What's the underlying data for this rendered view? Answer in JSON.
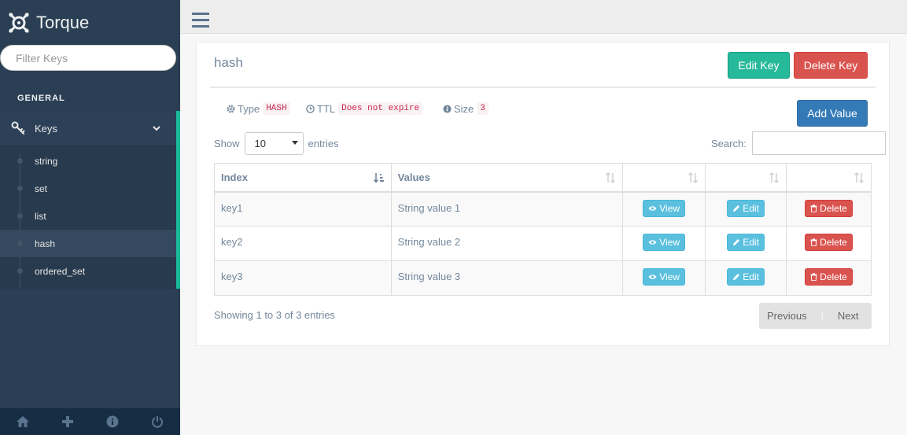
{
  "app": {
    "title": "Torque"
  },
  "sidebar": {
    "filter_placeholder": "Filter Keys",
    "section": "GENERAL",
    "group_label": "Keys",
    "items": [
      {
        "label": "string"
      },
      {
        "label": "set"
      },
      {
        "label": "list"
      },
      {
        "label": "hash"
      },
      {
        "label": "ordered_set"
      }
    ],
    "active_item": "hash"
  },
  "panel": {
    "title": "hash",
    "edit_key": "Edit Key",
    "delete_key": "Delete Key",
    "add_value": "Add Value",
    "meta": {
      "type_label": "Type",
      "type_value": "HASH",
      "ttl_label": "TTL",
      "ttl_value": "Does not expire",
      "size_label": "Size",
      "size_value": "3"
    }
  },
  "table": {
    "show_label": "Show",
    "page_size": "10",
    "entries_label": "entries",
    "search_label": "Search:",
    "columns": [
      "Index",
      "Values",
      "",
      "",
      ""
    ],
    "rows": [
      {
        "index": "key1",
        "value": "String value 1"
      },
      {
        "index": "key2",
        "value": "String value 2"
      },
      {
        "index": "key3",
        "value": "String value 3"
      }
    ],
    "view_label": "View",
    "edit_label": "Edit",
    "delete_label": "Delete",
    "info": "Showing 1 to 3 of 3 entries",
    "pagination": {
      "previous": "Previous",
      "current": "1",
      "next": "Next"
    }
  },
  "colors": {
    "sidebar_bg": "#2a3f54",
    "accent": "#1abb9c",
    "success": "#26b99a",
    "danger": "#d9534f",
    "primary": "#337ab7",
    "info": "#5bc0de"
  }
}
